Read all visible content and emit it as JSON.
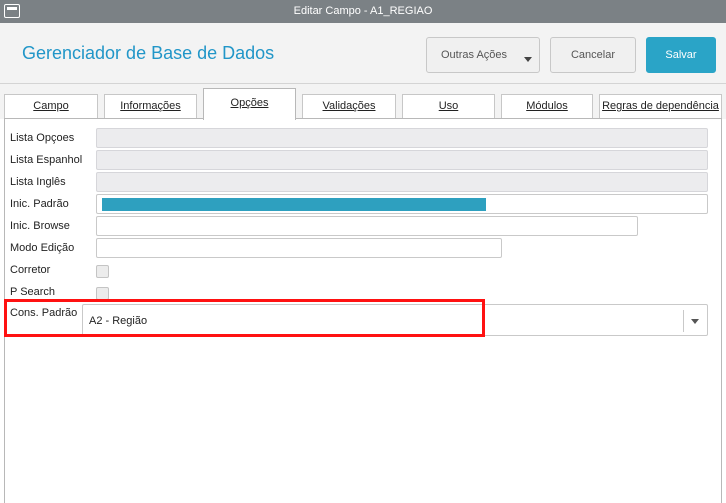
{
  "window": {
    "title": "Editar Campo - A1_REGIAO"
  },
  "header": {
    "app_title": "Gerenciador de Base de Dados",
    "outras_acoes_label": "Outras Ações",
    "cancelar_label": "Cancelar",
    "salvar_label": "Salvar"
  },
  "tabs": [
    {
      "label": "Campo"
    },
    {
      "label": "Informações"
    },
    {
      "label": "Opções"
    },
    {
      "label": "Validações"
    },
    {
      "label": "Uso"
    },
    {
      "label": "Módulos"
    },
    {
      "label": "Regras de dependência"
    }
  ],
  "active_tab": "Opções",
  "form": {
    "lista_opcoes": {
      "label": "Lista Opçoes",
      "value": ""
    },
    "lista_espanhol": {
      "label": "Lista Espanhol",
      "value": ""
    },
    "lista_ingles": {
      "label": "Lista Inglês",
      "value": ""
    },
    "inic_padrao": {
      "label": "Inic. Padrão",
      "value": ""
    },
    "inic_browse": {
      "label": "Inic. Browse",
      "value": ""
    },
    "modo_edicao": {
      "label": "Modo Edição",
      "value": ""
    },
    "corretor": {
      "label": "Corretor",
      "checked": false
    },
    "p_search": {
      "label": "P Search",
      "checked": false
    },
    "cons_padrao": {
      "label": "Cons. Padrão",
      "value": "A2 - Região"
    }
  },
  "colors": {
    "accent": "#2196c8",
    "primary_button": "#2aa4c7",
    "highlight": "#ff1111",
    "titlebar": "#7b8185"
  }
}
